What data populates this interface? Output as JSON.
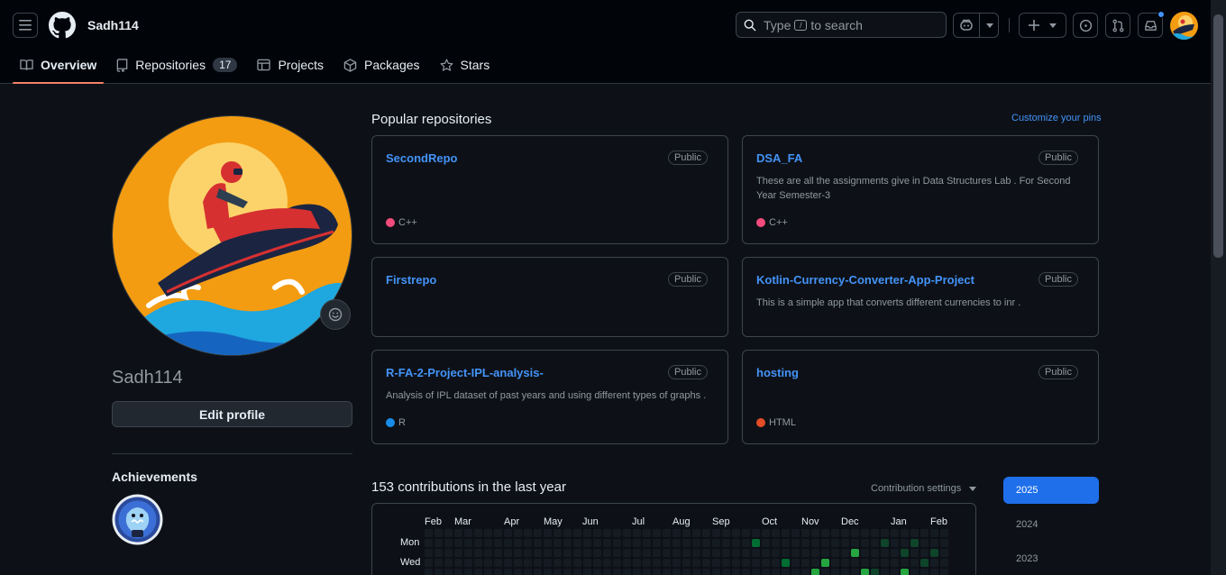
{
  "header": {
    "username": "Sadh114",
    "search_prefix": "Type",
    "search_key": "/",
    "search_suffix": "to search"
  },
  "tabs": [
    {
      "label": "Overview",
      "icon": "book-icon"
    },
    {
      "label": "Repositories",
      "icon": "repo-icon",
      "count": "17"
    },
    {
      "label": "Projects",
      "icon": "table-icon"
    },
    {
      "label": "Packages",
      "icon": "package-icon"
    },
    {
      "label": "Stars",
      "icon": "star-icon"
    }
  ],
  "profile": {
    "login": "Sadh114",
    "edit_label": "Edit profile",
    "achievements_title": "Achievements"
  },
  "popular": {
    "title": "Popular repositories",
    "customize": "Customize your pins",
    "repos": [
      {
        "name": "SecondRepo",
        "visibility": "Public",
        "description": "",
        "language": "C++",
        "lang_color": "#f34b7d"
      },
      {
        "name": "DSA_FA",
        "visibility": "Public",
        "description": "These are all the assignments give in Data Structures Lab . For Second Year Semester-3",
        "language": "C++",
        "lang_color": "#f34b7d"
      },
      {
        "name": "Firstrepo",
        "visibility": "Public",
        "description": "",
        "language": "",
        "lang_color": ""
      },
      {
        "name": "Kotlin-Currency-Converter-App-Project",
        "visibility": "Public",
        "description": "This is a simple app that converts different currencies to inr .",
        "language": "",
        "lang_color": ""
      },
      {
        "name": "R-FA-2-Project-IPL-analysis-",
        "visibility": "Public",
        "description": "Analysis of IPL dataset of past years and using different types of graphs .",
        "language": "R",
        "lang_color": "#198ce7"
      },
      {
        "name": "hosting",
        "visibility": "Public",
        "description": "",
        "language": "HTML",
        "lang_color": "#e34c26"
      }
    ]
  },
  "contributions": {
    "title": "153 contributions in the last year",
    "settings": "Contribution settings",
    "months": [
      "Feb",
      "Mar",
      "Apr",
      "May",
      "Jun",
      "Jul",
      "Aug",
      "Sep",
      "Oct",
      "Nov",
      "Dec",
      "Jan",
      "Feb"
    ],
    "weekdays": [
      "Mon",
      "Wed"
    ]
  },
  "years": [
    "2025",
    "2024",
    "2023"
  ],
  "colors": {
    "accent": "#4493f8",
    "tab_underline": "#f78166",
    "year_active": "#1f6feb"
  }
}
